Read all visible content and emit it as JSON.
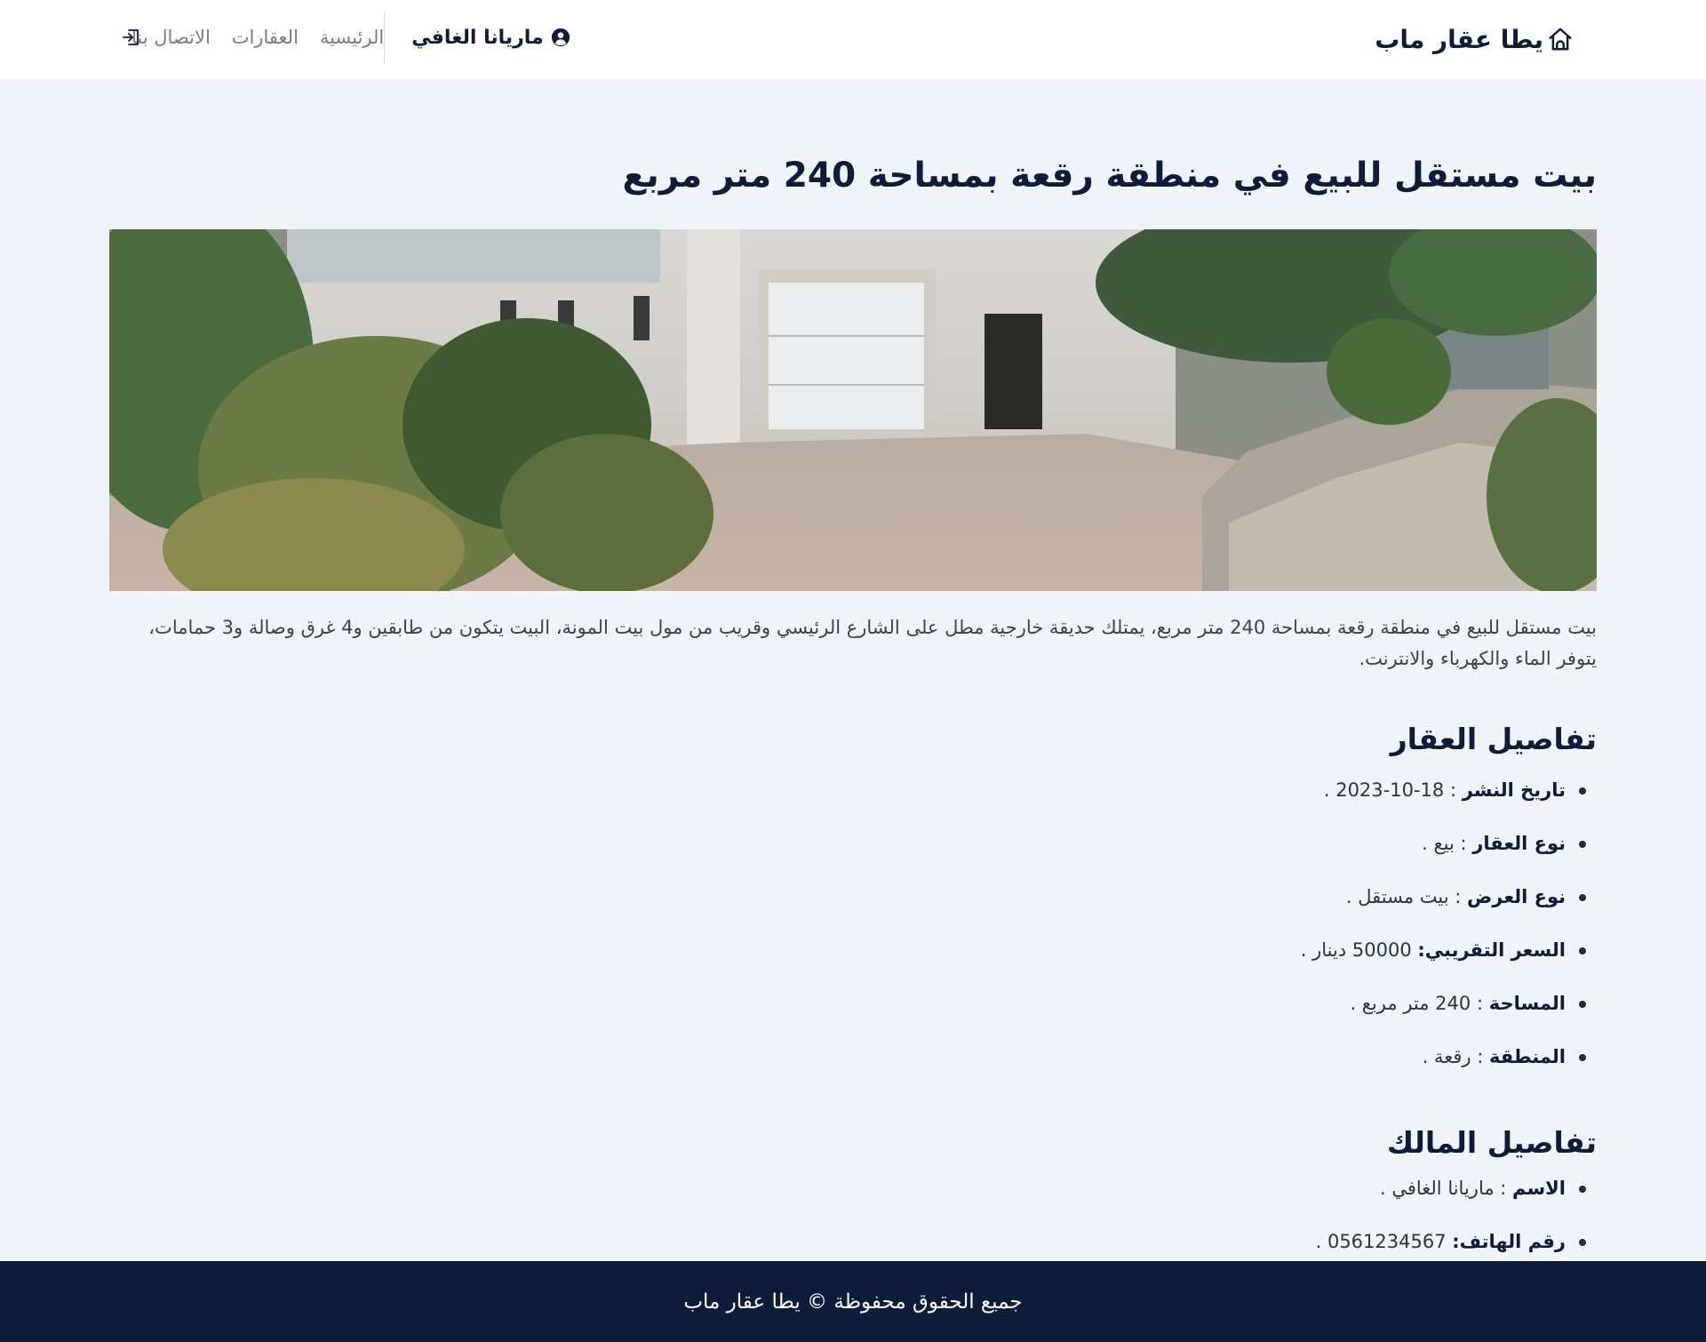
{
  "header": {
    "brand": "يطا عقار ماب",
    "brand_icon": "house-icon",
    "nav": [
      "الرئيسية",
      "العقارات",
      "الاتصال بنا"
    ],
    "user_name": "ماريانا الغافي",
    "user_icon": "user-circle-icon",
    "logout_icon": "logout-icon"
  },
  "property": {
    "title": "بيت مستقل للبيع في منطقة رقعة بمساحة 240 متر مربع",
    "image_icon": "property-photo",
    "description": "بيت مستقل للبيع في منطقة رقعة بمساحة 240 متر مربع، يمتلك حديقة خارجية مطل على الشارع الرئيسي وقريب من مول بيت المونة، البيت يتكون من طابقين و4 غرق وصالة و3 حمامات، يتوفر الماء والكهرباء والانترنت."
  },
  "details": {
    "title": "تفاصيل العقار",
    "items": [
      {
        "label": "تاريخ النشر",
        "sep": " : ",
        "value": "18-10-2023 ."
      },
      {
        "label": "نوع العقار",
        "sep": " : ",
        "value": "بيع ."
      },
      {
        "label": "نوع العرض",
        "sep": " : ",
        "value": "بيت مستقل ."
      },
      {
        "label": "السعر التقريبي:",
        "sep": " ",
        "value": "50000 دينار ."
      },
      {
        "label": "المساحة",
        "sep": " : ",
        "value": "240 متر مربع ."
      },
      {
        "label": "المنطقة",
        "sep": " : ",
        "value": "رقعة ."
      }
    ]
  },
  "owner": {
    "title": "تفاصيل المالك",
    "items": [
      {
        "label": "الاسم",
        "sep": " : ",
        "value": "ماريانا الغافي ."
      },
      {
        "label": "رقم الهاتف:",
        "sep": " ",
        "value": "0561234567 ."
      }
    ]
  },
  "footer": {
    "text": "جميع الحقوق محفوظة © يطا عقار ماب"
  },
  "colors": {
    "navy": "#0e1c3a",
    "background": "#f0f3f8",
    "nav_text": "#777d87"
  }
}
